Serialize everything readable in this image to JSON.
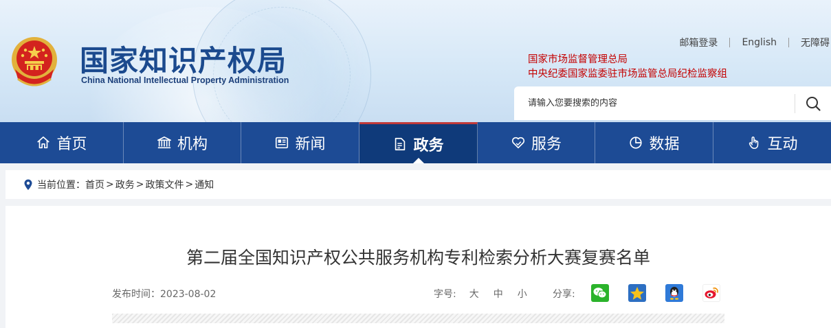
{
  "header": {
    "title_cn": "国家知识产权局",
    "title_en": "China National Intellectual Property Administration",
    "top_links": [
      "邮箱登录",
      "English",
      "无障碍"
    ],
    "agency_links": [
      "国家市场监督管理总局",
      "中央纪委国家监委驻市场监管总局纪检监察组"
    ],
    "search": {
      "placeholder": "请输入您要搜索的内容",
      "icon": "search-icon"
    }
  },
  "nav": {
    "items": [
      {
        "label": "首页",
        "icon": "home-icon"
      },
      {
        "label": "机构",
        "icon": "institution-icon"
      },
      {
        "label": "新闻",
        "icon": "news-icon"
      },
      {
        "label": "政务",
        "icon": "document-icon",
        "active": true
      },
      {
        "label": "服务",
        "icon": "heart-hand-icon"
      },
      {
        "label": "数据",
        "icon": "pie-chart-icon"
      },
      {
        "label": "互动",
        "icon": "hand-pointer-icon"
      }
    ],
    "active_color": "#0f3a7a",
    "bar_color": "#1d4b95",
    "accent_color": "#c03a3a"
  },
  "breadcrumb": {
    "prefix": "当前位置：",
    "items": [
      "首页",
      "政务",
      "政策文件",
      "通知"
    ],
    "separator": ">"
  },
  "article": {
    "title": "第二届全国知识产权公共服务机构专利检索分析大赛复赛名单",
    "date_text": "发布时间：2023-08-02",
    "font_size_label": "字号:",
    "font_sizes": [
      "大",
      "中",
      "小"
    ],
    "share_label": "分享:",
    "share_icons": [
      "wechat-icon",
      "qzone-icon",
      "qq-icon",
      "weibo-icon"
    ]
  }
}
